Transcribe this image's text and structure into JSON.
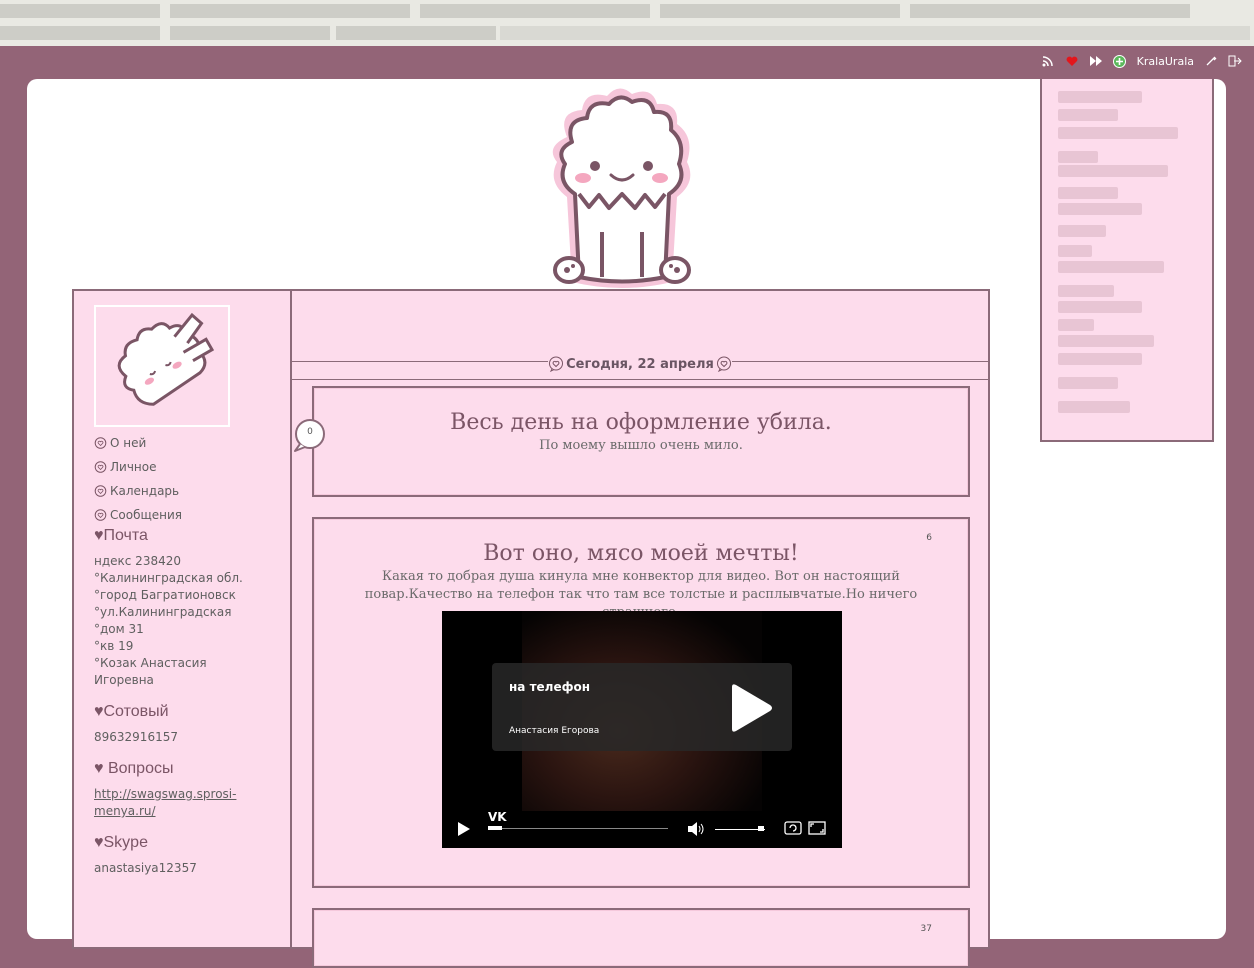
{
  "toolbar": {
    "username": "KralaUrala",
    "icons": [
      "rss-icon",
      "heart-icon",
      "fast-forward-icon",
      "plus-circle-icon",
      "settings-icon",
      "logout-icon"
    ],
    "colors": {
      "heart": "#e3161c",
      "plus": "#5cb85c"
    }
  },
  "sidebar": {
    "nav": [
      {
        "label": "О ней"
      },
      {
        "label": "Личное"
      },
      {
        "label": "Календарь"
      },
      {
        "label": "Сообщения"
      }
    ],
    "mail_title": "♥Почта",
    "mail_body": "ндекс 238420\n°Калининградская обл.\n°город Багратионовск\n°ул.Калининградская\n°дом 31\n°кв 19\n°Козак Анастасия Игоревна",
    "phone_title": "♥Сотовый",
    "phone_body": "89632916157",
    "questions_title": "♥ Вопросы",
    "questions_link": "http://swagswag.sprosi-menya.ru/",
    "skype_title": "♥Skype",
    "skype_body": "anastasiya12357"
  },
  "main": {
    "date": "Сегодня, 22 апреля",
    "posts": [
      {
        "title": "Весь день на оформление убила.",
        "body": "По моему вышло очень мило.",
        "comments": "0"
      },
      {
        "title": "Вот оно, мясо моей мечты!",
        "body": "Какая то добрая душа кинула мне конвектор для видео. Вот он настоящий повар.Качество на телефон так что там все толстые и расплывчатые.Но ничего страшного.",
        "count": "6",
        "video": {
          "title": "на телефон",
          "author": "Анастасия Егорова",
          "brand": "VK",
          "progress": 0.08,
          "volume": 0.8
        }
      },
      {
        "count": "37"
      }
    ]
  },
  "colors": {
    "background": "#936477",
    "panel": "#fddcec",
    "border": "#8b6a79",
    "title": "#7b5566"
  }
}
